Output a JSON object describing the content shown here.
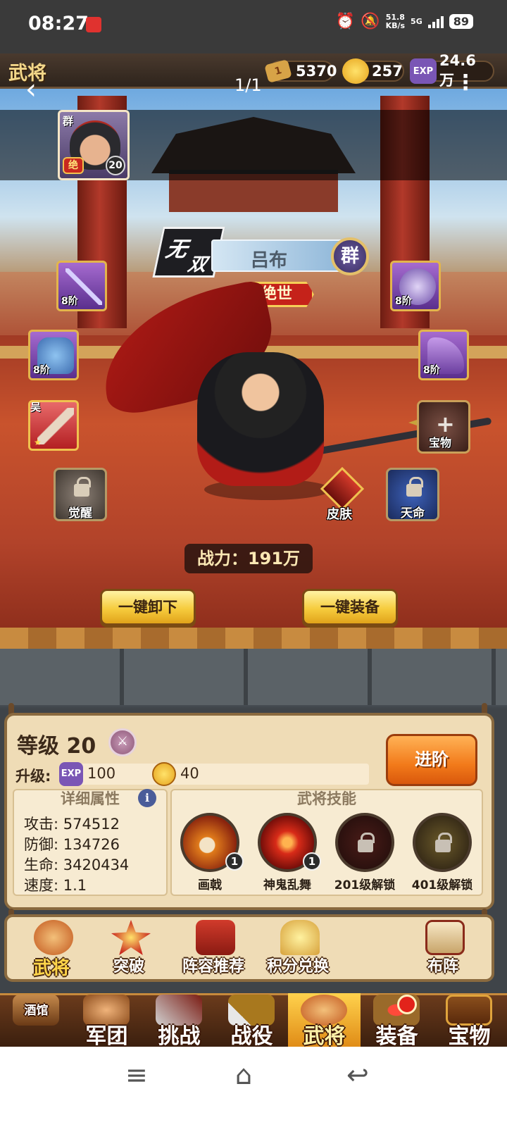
{
  "status_bar": {
    "time": "08:27",
    "net_speed_value": "51.8",
    "net_speed_unit": "KB/s",
    "network": "5G",
    "battery": "89"
  },
  "hud": {
    "title": "武将",
    "resources": [
      {
        "icon": "ticket-icon",
        "icon_text": "1",
        "value": "5370"
      },
      {
        "icon": "gold-coin-icon",
        "icon_text": "",
        "value": "257"
      },
      {
        "icon": "exp-icon",
        "icon_text": "EXP",
        "value": "24.6万"
      }
    ],
    "back_glyph": "‹",
    "page_indicator": "1/1",
    "more_glyph": "⋮"
  },
  "selected_hero_card": {
    "faction": "群",
    "rank": "绝",
    "level": "20"
  },
  "hero": {
    "title_char_1": "无",
    "title_char_2": "双",
    "name": "吕布",
    "faction": "群",
    "grade": "绝世",
    "power_label": "战力：",
    "power_value": "191万"
  },
  "equipment": {
    "weapon_tier": "8阶",
    "armor_tier": "8阶",
    "helmet_tier": "8阶",
    "boots_tier": "8阶",
    "relic_faction": "吴",
    "relic_star": "★",
    "treasure_plus": "+",
    "treasure_label": "宝物",
    "awaken_label": "觉醒",
    "destiny_label": "天命",
    "skin_label": "皮肤"
  },
  "actions": {
    "unequip_all": "一键卸下",
    "equip_all": "一键装备"
  },
  "info_panel": {
    "level_label": "等级 20",
    "upgrade_label": "升级:",
    "exp_icon_text": "EXP",
    "exp_cost": "100",
    "gold_cost": "40",
    "advance_button": "进阶",
    "attributes_title": "详细属性",
    "info_glyph": "i",
    "attributes": [
      {
        "key": "攻击:",
        "value": "574512"
      },
      {
        "key": "防御:",
        "value": "134726"
      },
      {
        "key": "生命:",
        "value": "3420434"
      },
      {
        "key": "速度:",
        "value": "1.1"
      }
    ],
    "skills_title": "武将技能",
    "skills": [
      {
        "name": "画戟",
        "level": "1",
        "locked": false
      },
      {
        "name": "神鬼乱舞",
        "level": "1",
        "locked": false
      },
      {
        "name": "201级解锁",
        "level": "",
        "locked": true
      },
      {
        "name": "401级解锁",
        "level": "",
        "locked": true
      }
    ]
  },
  "sub_tabs": [
    {
      "label": "武将",
      "active": true
    },
    {
      "label": "突破",
      "active": false
    },
    {
      "label": "阵容推荐",
      "active": false
    },
    {
      "label": "积分兑换",
      "active": false
    },
    {
      "label": "布阵",
      "active": false
    }
  ],
  "main_tabs": [
    {
      "label": "酒馆",
      "active": false
    },
    {
      "label": "军团",
      "active": false
    },
    {
      "label": "挑战",
      "active": false
    },
    {
      "label": "战役",
      "active": false
    },
    {
      "label": "武将",
      "active": true
    },
    {
      "label": "装备",
      "active": false
    },
    {
      "label": "宝物",
      "active": false
    }
  ],
  "system_nav": {
    "menu_glyph": "≡",
    "home_glyph": "⌂",
    "back_glyph": "↩"
  },
  "colors": {
    "accent_gold": "#f6cc3e",
    "advance_orange": "#f27a1a",
    "grade_red": "#c5221a",
    "panel_bg": "#efdcb6"
  }
}
